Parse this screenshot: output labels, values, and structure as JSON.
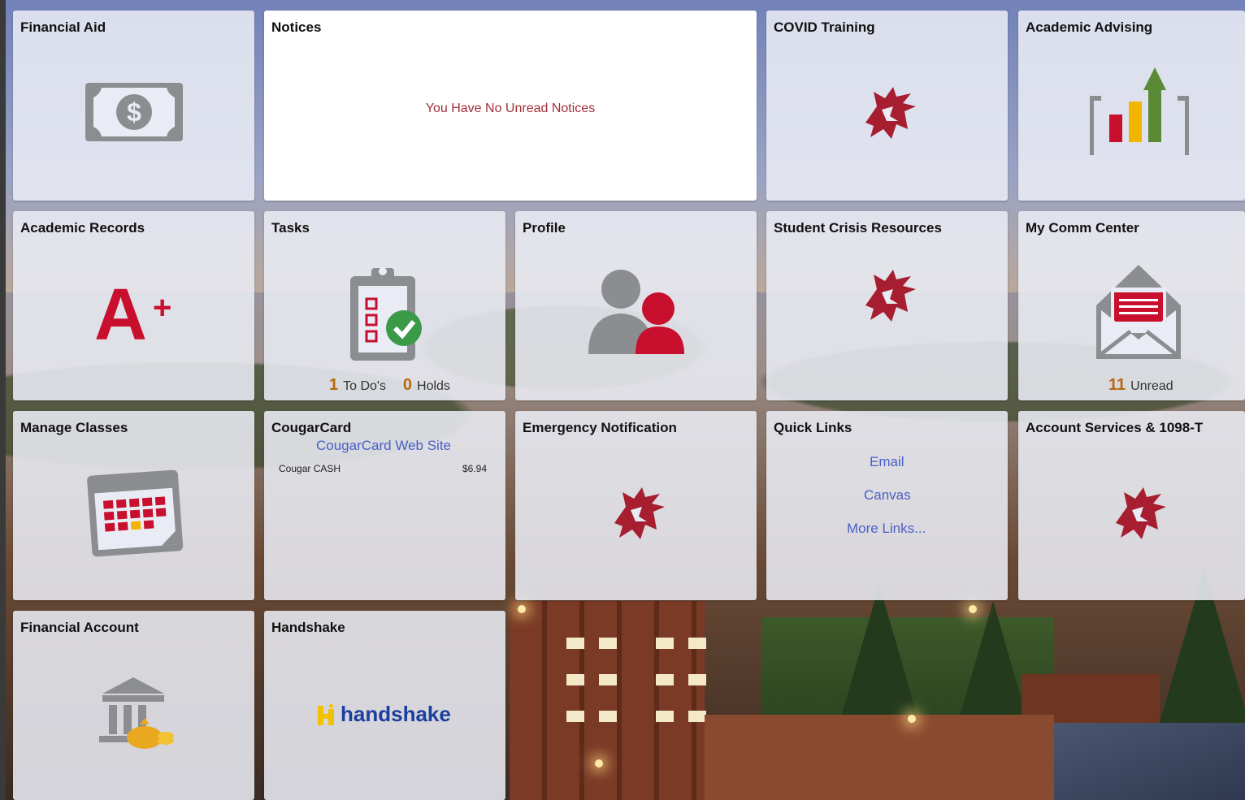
{
  "colors": {
    "wsu_crimson": "#a61e2f",
    "icon_gray": "#8b8d90",
    "link_blue": "#4a5fc4",
    "count_orange": "#b86a10",
    "notice_red": "#a0303a"
  },
  "tiles": {
    "financial_aid": {
      "title": "Financial Aid",
      "icon": "money-icon"
    },
    "notices": {
      "title": "Notices",
      "message": "You Have No Unread Notices"
    },
    "covid_training": {
      "title": "COVID Training",
      "icon": "cougar-logo-icon"
    },
    "academic_advising": {
      "title": "Academic Advising",
      "icon": "bar-chart-arrow-icon"
    },
    "academic_records": {
      "title": "Academic Records",
      "icon": "a-plus-icon"
    },
    "tasks": {
      "title": "Tasks",
      "icon": "clipboard-checklist-icon",
      "todos_count": "1",
      "todos_label": "To Do's",
      "holds_count": "0",
      "holds_label": "Holds"
    },
    "profile": {
      "title": "Profile",
      "icon": "users-icon"
    },
    "student_crisis": {
      "title": "Student Crisis Resources",
      "icon": "cougar-logo-icon"
    },
    "comm_center": {
      "title": "My Comm Center",
      "icon": "envelope-icon",
      "unread_count": "11",
      "unread_label": "Unread"
    },
    "manage_classes": {
      "title": "Manage Classes",
      "icon": "calendar-icon"
    },
    "cougarcard": {
      "title": "CougarCard",
      "link": "CougarCard Web Site",
      "balance_label": "Cougar CASH",
      "balance_value": "$6.94"
    },
    "emergency": {
      "title": "Emergency Notification",
      "icon": "cougar-logo-icon"
    },
    "quick_links": {
      "title": "Quick Links",
      "links": [
        "Email",
        "Canvas",
        "More Links..."
      ]
    },
    "account_services": {
      "title": "Account Services & 1098-T",
      "icon": "cougar-logo-icon"
    },
    "financial_account": {
      "title": "Financial Account",
      "icon": "bank-coins-icon"
    },
    "handshake": {
      "title": "Handshake",
      "logo_text": "handshake"
    }
  }
}
